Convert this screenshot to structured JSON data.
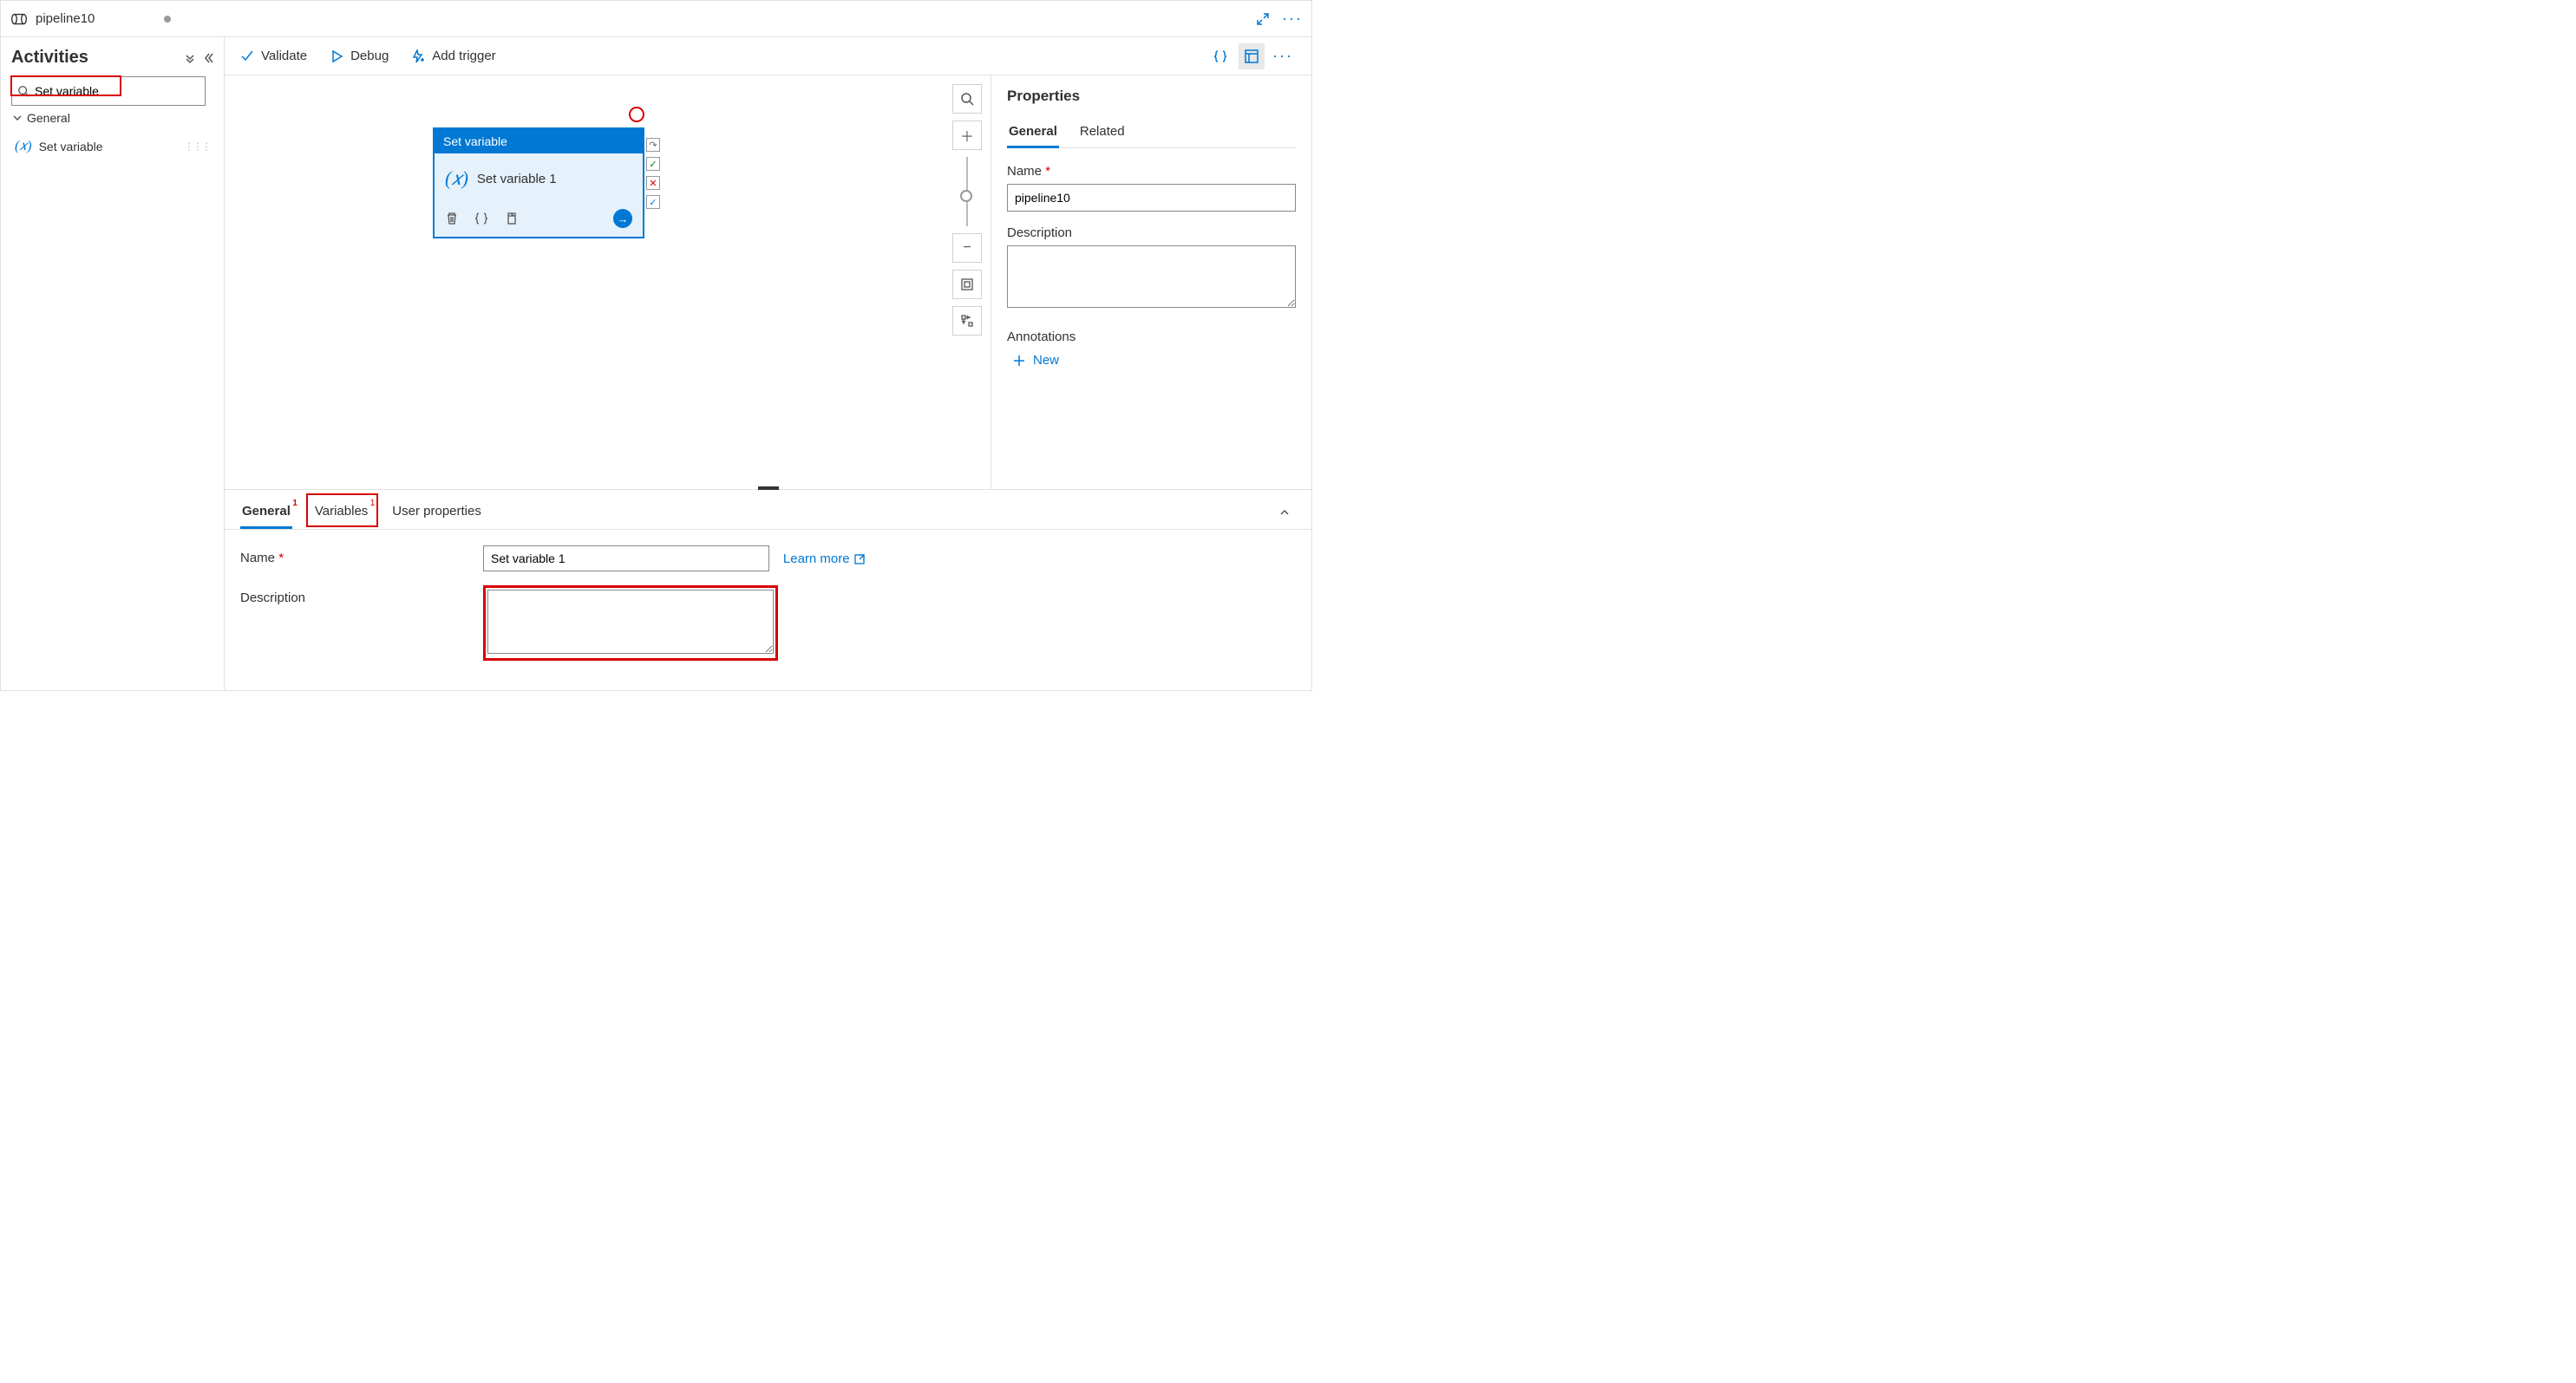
{
  "tab": {
    "title": "pipeline10"
  },
  "sidebar": {
    "title": "Activities",
    "search_value": "Set variable",
    "category": "General",
    "items": [
      {
        "label": "Set variable"
      }
    ]
  },
  "toolbar": {
    "validate": "Validate",
    "debug": "Debug",
    "add_trigger": "Add trigger"
  },
  "node": {
    "type_label": "Set variable",
    "name": "Set variable 1"
  },
  "bottom_tabs": {
    "general": "General",
    "general_badge": "1",
    "variables": "Variables",
    "variables_badge": "1",
    "user_properties": "User properties"
  },
  "form": {
    "name_label": "Name",
    "name_value": "Set variable 1",
    "desc_label": "Description",
    "desc_value": "",
    "learn_more": "Learn more"
  },
  "properties": {
    "title": "Properties",
    "tab_general": "General",
    "tab_related": "Related",
    "name_label": "Name",
    "name_value": "pipeline10",
    "desc_label": "Description",
    "desc_value": "",
    "annotations_title": "Annotations",
    "new_label": "New"
  }
}
